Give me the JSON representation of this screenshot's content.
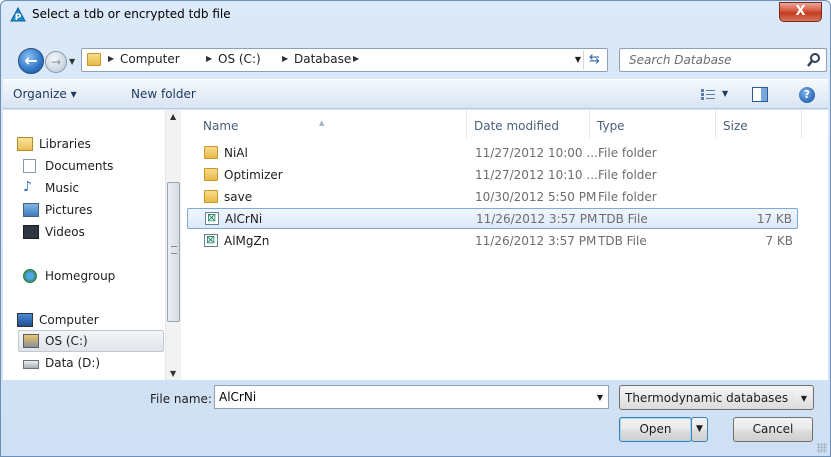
{
  "window": {
    "title": "Select a tdb or encrypted tdb file",
    "close_label": "X"
  },
  "address": {
    "crumbs": [
      "Computer",
      "OS (C:)",
      "Database"
    ]
  },
  "search": {
    "placeholder": "Search Database"
  },
  "toolbar": {
    "organize_label": "Organize ▾",
    "new_folder_label": "New folder"
  },
  "nav": {
    "libraries": "Libraries",
    "documents": "Documents",
    "music": "Music",
    "pictures": "Pictures",
    "videos": "Videos",
    "homegroup": "Homegroup",
    "computer": "Computer",
    "os_c": "OS (C:)",
    "data_d": "Data (D:)"
  },
  "columns": {
    "name": "Name",
    "date": "Date modified",
    "type": "Type",
    "size": "Size"
  },
  "files": [
    {
      "name": "NiAl",
      "date": "11/27/2012 10:00 ...",
      "type": "File folder",
      "size": "",
      "kind": "folder"
    },
    {
      "name": "Optimizer",
      "date": "11/27/2012 10:10 ...",
      "type": "File folder",
      "size": "",
      "kind": "folder"
    },
    {
      "name": "save",
      "date": "10/30/2012 5:50 PM",
      "type": "File folder",
      "size": "",
      "kind": "folder"
    },
    {
      "name": "AlCrNi",
      "date": "11/26/2012 3:57 PM",
      "type": "TDB File",
      "size": "17 KB",
      "kind": "file"
    },
    {
      "name": "AlMgZn",
      "date": "11/26/2012 3:57 PM",
      "type": "TDB File",
      "size": "7 KB",
      "kind": "file"
    }
  ],
  "bottom": {
    "file_name_label": "File name:",
    "file_name_value": "AlCrNi",
    "filter_label": "Thermodynamic databases (*.tdb",
    "open_label": "Open",
    "cancel_label": "Cancel"
  }
}
